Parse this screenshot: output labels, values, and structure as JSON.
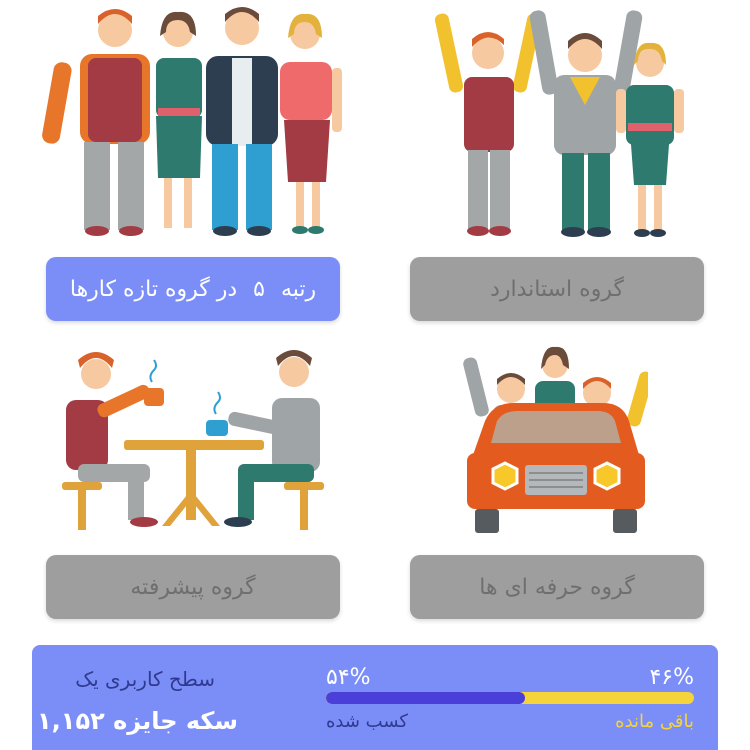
{
  "groups": {
    "standard": {
      "label": "گروه استاندارد"
    },
    "fresh": {
      "rank_prefix": "رتبه",
      "rank": "۵",
      "rank_suffix": "در گروه تازه کارها"
    },
    "professional": {
      "label": "گروه حرفه ای ها"
    },
    "advanced": {
      "label": "گروه پیشرفته"
    }
  },
  "footer": {
    "level_title": "سطح کاربری یک",
    "coins": "سکه جایزه ۱,۱۵۲",
    "earned_percent": "۵۴%",
    "earned_label": "کسب شده",
    "remaining_percent": "۴۶%",
    "remaining_label": "باقی مانده",
    "progress": 0.54
  },
  "colors": {
    "accent": "#7b8ef8",
    "gray_button": "#9e9e9e",
    "progress_fill": "#4a3fd8",
    "progress_rest": "#f5d33a"
  }
}
